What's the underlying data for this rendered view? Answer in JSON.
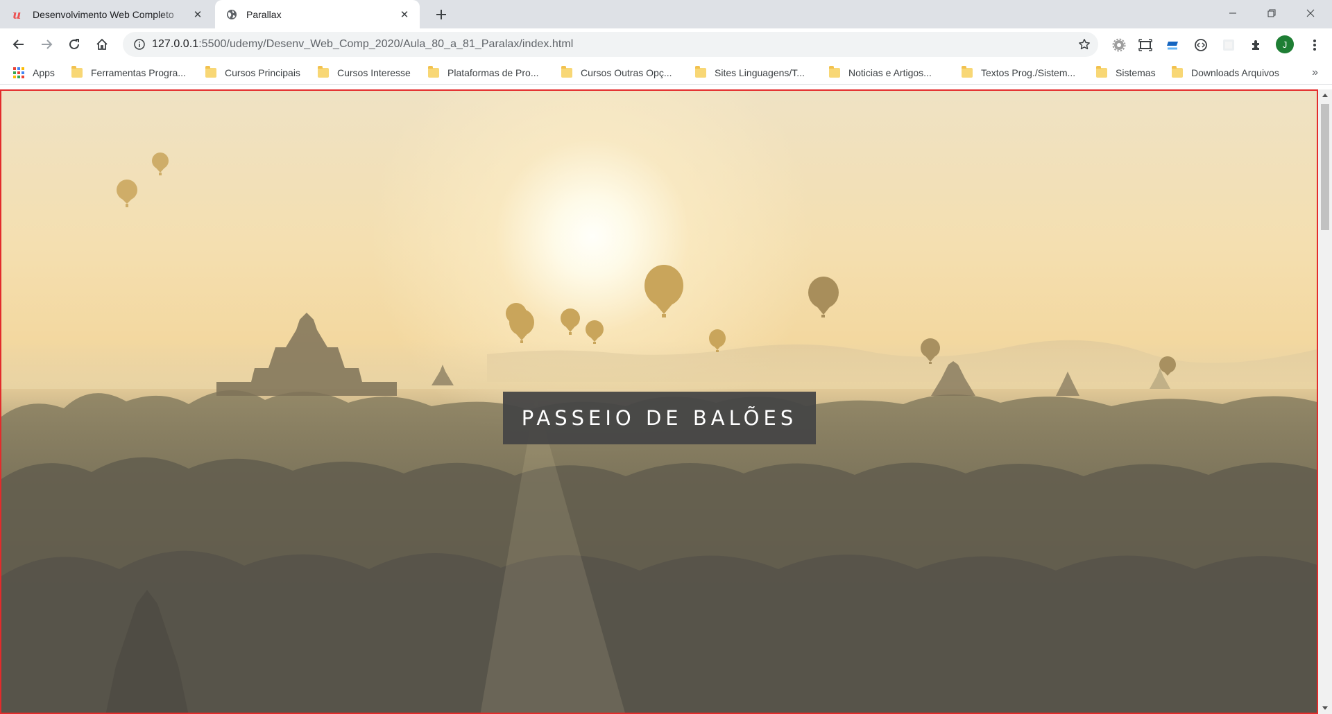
{
  "tabs": [
    {
      "title": "Desenvolvimento Web Completo",
      "icon": "udemy-icon",
      "active": false
    },
    {
      "title": "Parallax",
      "icon": "globe-icon",
      "active": true
    }
  ],
  "address_bar": {
    "host": "127.0.0.1",
    "path": ":5500/udemy/Desenv_Web_Comp_2020/Aula_80_a_81_Paralax/index.html"
  },
  "profile": {
    "initial": "J",
    "color": "#1e7e34"
  },
  "bookmarks": {
    "apps_label": "Apps",
    "folders": [
      "Ferramentas Progra...",
      "Cursos Principais",
      "Cursos Interesse",
      "Plataformas de Pro...",
      "Cursos Outras Opç...",
      "Sites Linguagens/T...",
      "Noticias e Artigos...",
      "Textos Prog./Sistem...",
      "Sistemas",
      "Downloads Arquivos"
    ],
    "more": "»"
  },
  "page": {
    "caption": "PASSEIO DE BALÕES",
    "caption_bg": "#464646",
    "frame_border_color": "#e32b2b"
  }
}
